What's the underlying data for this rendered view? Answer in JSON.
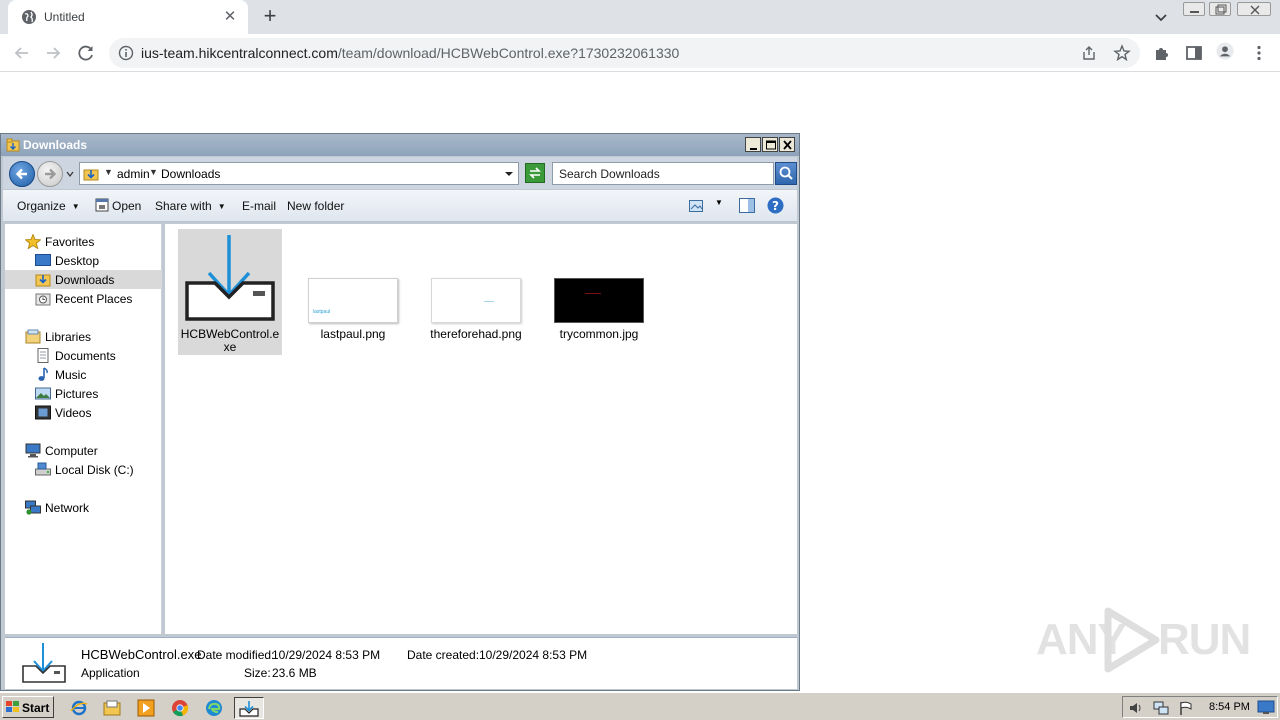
{
  "browser": {
    "tab_title": "Untitled",
    "new_tab_label": "+",
    "url_domain": "ius-team.hikcentralconnect.com",
    "url_path": "/team/download/HCBWebControl.exe?1730232061330"
  },
  "explorer": {
    "window_title": "Downloads",
    "breadcrumb": [
      "admin",
      "Downloads"
    ],
    "search_placeholder": "Search Downloads",
    "commands": {
      "organize": "Organize",
      "open": "Open",
      "share_with": "Share with",
      "email": "E-mail",
      "new_folder": "New folder"
    },
    "nav": {
      "favorites": "Favorites",
      "desktop": "Desktop",
      "downloads": "Downloads",
      "recent_places": "Recent Places",
      "libraries": "Libraries",
      "documents": "Documents",
      "music": "Music",
      "pictures": "Pictures",
      "videos": "Videos",
      "computer": "Computer",
      "local_disk": "Local Disk (C:)",
      "network": "Network"
    },
    "files": [
      {
        "name": "HCBWebControl.exe",
        "selected": true,
        "icon": "download-installer-icon"
      },
      {
        "name": "lastpaul.png",
        "thumb_caption": "lastpaul"
      },
      {
        "name": "thereforehad.png"
      },
      {
        "name": "trycommon.jpg"
      }
    ],
    "details": {
      "name": "HCBWebControl.exe",
      "type": "Application",
      "date_modified_label": "Date modified:",
      "date_modified": "10/29/2024 8:53 PM",
      "date_created_label": "Date created:",
      "date_created": "10/29/2024 8:53 PM",
      "size_label": "Size:",
      "size": "23.6 MB"
    }
  },
  "taskbar": {
    "start_label": "Start",
    "clock": "8:54 PM"
  },
  "watermark": {
    "text_left": "ANY",
    "text_right": "RUN"
  },
  "colors": {
    "selection": "#d9d9d9",
    "chrome_tabbar": "#dee1e6",
    "explorer_chrome": "#c0c8d2",
    "download_arrow": "#1e90d8"
  }
}
